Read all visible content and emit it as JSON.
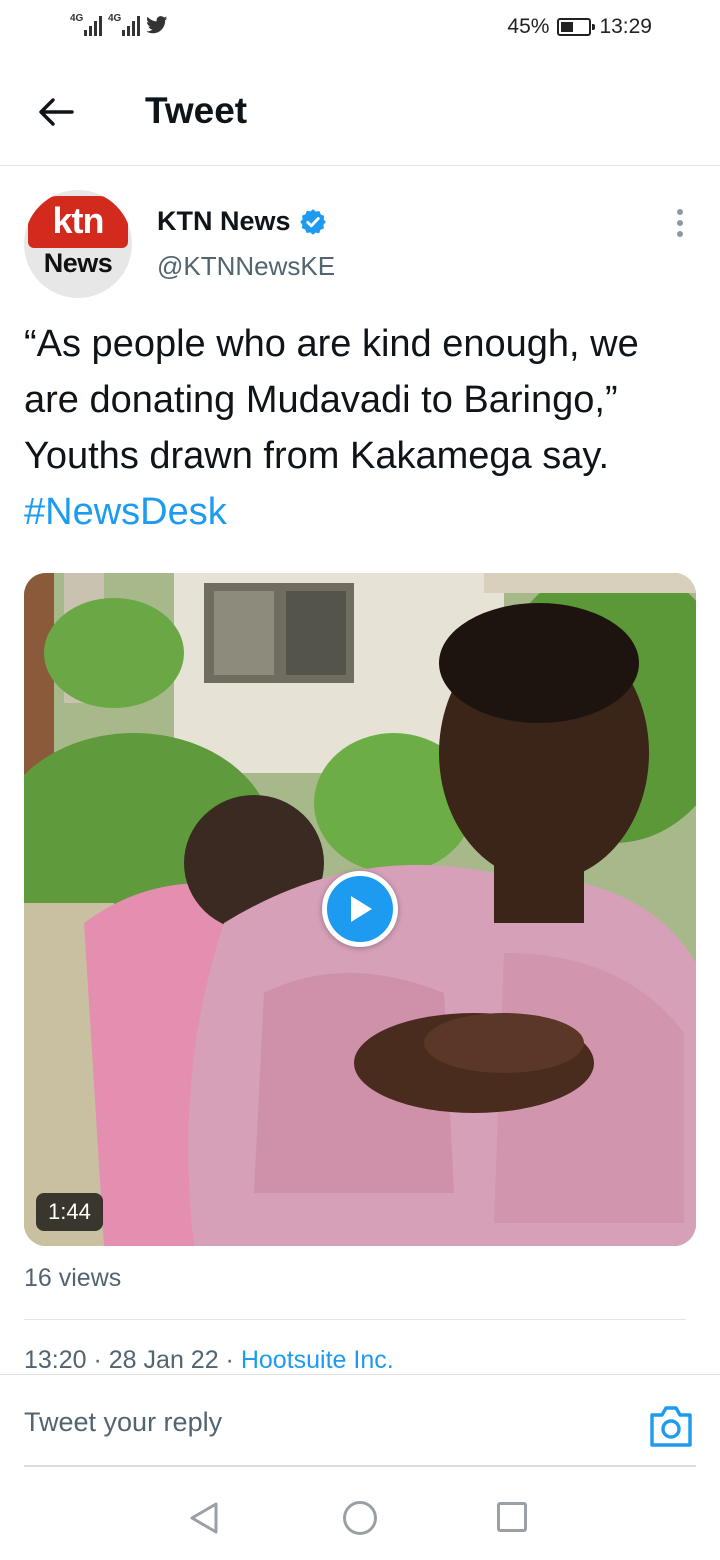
{
  "status_bar": {
    "signal1_tag": "4G",
    "signal2_tag": "4G",
    "notification_icon": "twitter-bird-icon",
    "battery_percent": "45%",
    "battery_level": 0.45,
    "time": "13:29"
  },
  "header": {
    "back_icon": "arrow-left-icon",
    "title": "Tweet"
  },
  "tweet": {
    "avatar_text_top": "ktn",
    "avatar_text_bottom": "News",
    "author_name": "KTN News",
    "verified_icon": "verified-badge-icon",
    "handle": "@KTNNewsKE",
    "text": "“As people who are kind enough, we are donating Mudavadi to Baringo,” Youths drawn from Kakamega say. ",
    "hashtag": "#NewsDesk",
    "video": {
      "duration": "1:44",
      "play_icon": "play-icon"
    },
    "views": "16 views",
    "time": "13:20",
    "separator": " · ",
    "date": "28 Jan 22",
    "source": "Hootsuite Inc."
  },
  "reply_bar": {
    "placeholder": "Tweet your reply",
    "camera_icon": "camera-icon"
  },
  "colors": {
    "accent": "#1d9bf0",
    "text_primary": "#0f1419",
    "text_secondary": "#536471",
    "brand_red": "#d32a1e"
  }
}
